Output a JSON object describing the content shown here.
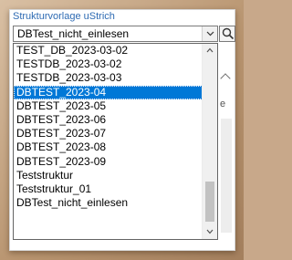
{
  "dialog": {
    "caption": "Strukturvorlage uStrich",
    "combo_value": "DBTest_nicht_einlesen",
    "behind_glyph": "e"
  },
  "dropdown": {
    "selected_index": 3,
    "items": [
      "TEST_DB_2023-03-02",
      "TESTDB_2023-03-02",
      "TESTDB_2023-03-03",
      "DBTEST_2023-04",
      "DBTEST_2023-05",
      "DBTEST_2023-06",
      "DBTEST_2023-07",
      "DBTEST_2023-08",
      "DBTEST_2023-09",
      "Teststruktur",
      "Teststruktur_01",
      "DBTest_nicht_einlesen"
    ]
  },
  "icons": {
    "combo_arrow": "chevron-down-icon",
    "search": "magnifier-icon",
    "scroll_up": "chevron-up-icon",
    "scroll_down": "chevron-down-icon"
  },
  "colors": {
    "caption": "#2e6bb3",
    "selection": "#0078d7"
  }
}
